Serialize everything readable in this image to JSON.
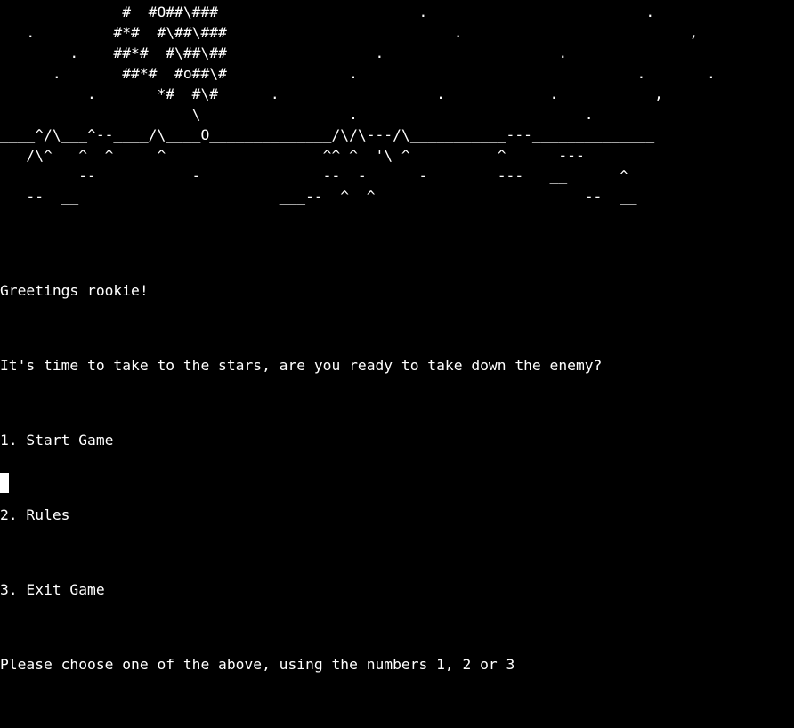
{
  "art": [
    "              #  #O##\\###                       .                         .",
    "   .         #*#  #\\##\\###                          .                          ,",
    "        .    ##*#  #\\##\\##                 .                    .",
    "      .       ##*#  #o##\\#              .                                .       .",
    "          .       *#  #\\#      .                  .            .           ,",
    "                      \\                 .                          .",
    "____^/\\___^--____/\\____O______________/\\/\\---/\\___________---______________",
    "   /\\^   ^  ^     ^                  ^^ ^  '\\ ^          ^      ---",
    "         --           -              --  -      -        ---   __      ^",
    "   --  __                       ___--  ^  ^                        --  __"
  ],
  "greeting": "Greetings rookie!",
  "intro": "It's time to take to the stars, are you ready to take down the enemy?",
  "menu": {
    "option_1": "1. Start Game",
    "option_2": "2. Rules",
    "option_3": "3. Exit Game"
  },
  "prompt": "Please choose one of the above, using the numbers 1, 2 or 3",
  "colors": {
    "background": "#000000",
    "text": "#ffffff"
  }
}
